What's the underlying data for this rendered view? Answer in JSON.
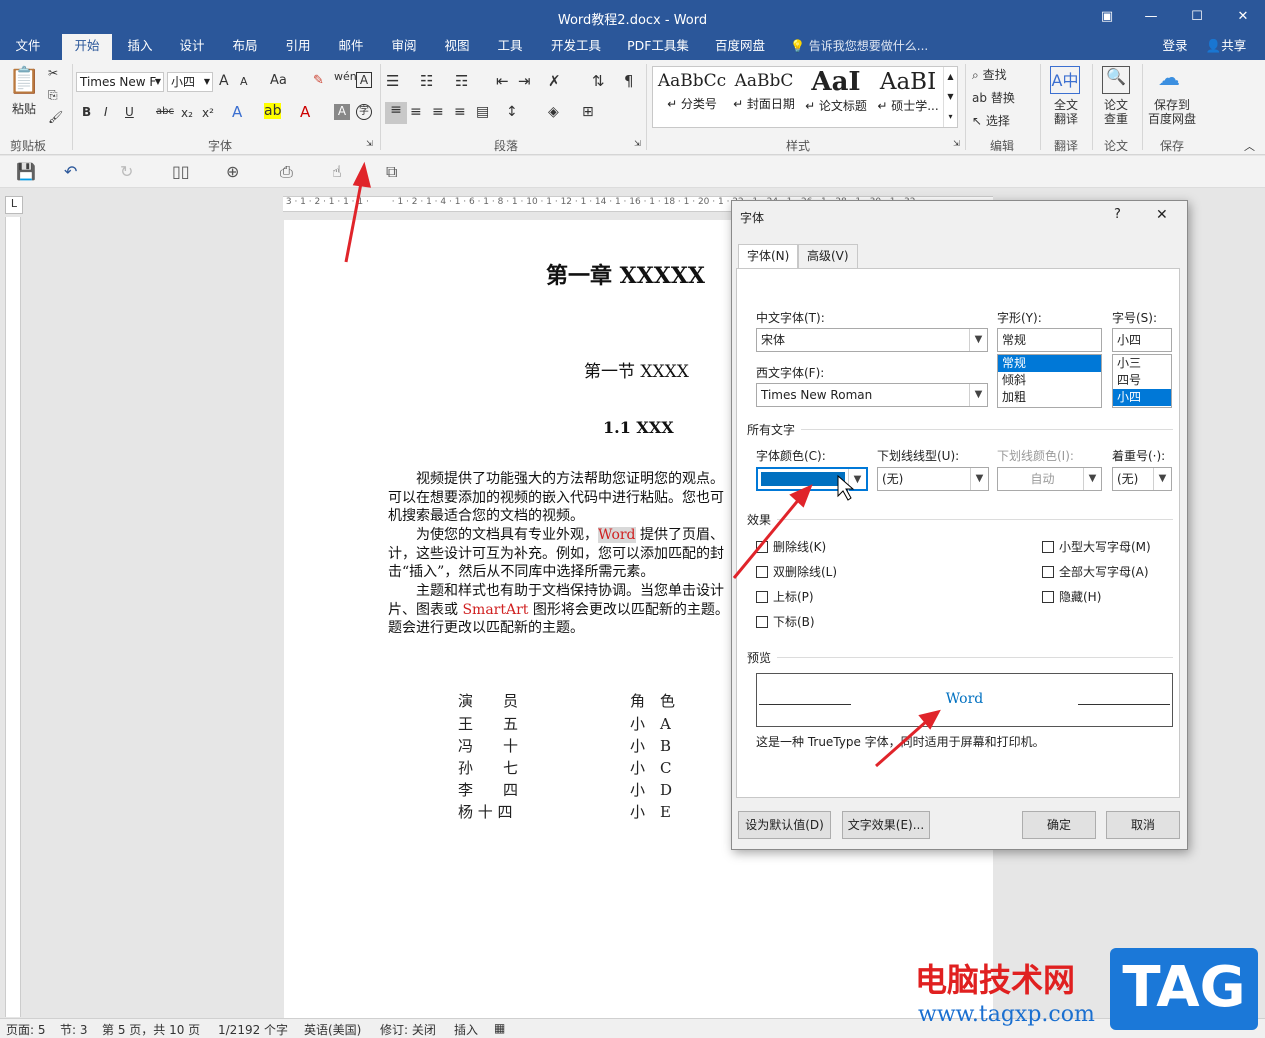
{
  "window": {
    "title": "Word教程2.docx - Word"
  },
  "tabs": [
    "文件",
    "开始",
    "插入",
    "设计",
    "布局",
    "引用",
    "邮件",
    "审阅",
    "视图",
    "工具",
    "开发工具",
    "PDF工具集",
    "百度网盘"
  ],
  "tellme": "告诉我您想要做什么...",
  "account": {
    "login": "登录",
    "share": "共享"
  },
  "ribbon": {
    "clipboard": {
      "paste": "粘贴",
      "label": "剪贴板"
    },
    "font": {
      "name": "Times New F",
      "size": "小四",
      "label": "字体",
      "bold": "B",
      "italic": "I",
      "underline": "U",
      "strike": "abc",
      "sub": "x₂",
      "sup": "x²",
      "grow": "A",
      "shrink": "A",
      "aa": "Aa",
      "clear": "✎"
    },
    "paragraph": {
      "label": "段落"
    },
    "styles": {
      "label": "样式",
      "items": [
        {
          "preview": "AaBbCc",
          "name": "↵ 分类号"
        },
        {
          "preview": "AaBbC",
          "name": "↵ 封面日期"
        },
        {
          "preview": "AaI",
          "name": "↵ 论文标题"
        },
        {
          "preview": "AaBI",
          "name": "↵ 硕士学..."
        }
      ]
    },
    "editing": {
      "find": "查找",
      "replace": "替换",
      "select": "选择",
      "label": "编辑"
    },
    "translate": {
      "btn": "全文\n翻译",
      "label": "翻译"
    },
    "paper": {
      "btn": "论文\n查重",
      "label": "论文"
    },
    "save": {
      "btn": "保存到\n百度网盘",
      "label": "保存"
    }
  },
  "document": {
    "chapter": "第一章  XXXXX",
    "section": "第一节  XXXX",
    "subsection": "1.1 XXX",
    "p1": [
      "　　视频提供了功能强大的方法帮助您证明您的观点。",
      "可以在想要添加的视频的嵌入代码中进行粘贴。您也可",
      "机搜索最适合您的文档的视频。"
    ],
    "p2_a": "　　为使您的文档具有专业外观，",
    "p2_word": "Word",
    "p2_b": " 提供了页眉、",
    "p2_lines": [
      "计，这些设计可互为补充。例如，您可以添加匹配的封",
      "击“插入”，然后从不同库中选择所需元素。"
    ],
    "p3": "　　主题和样式也有助于文档保持协调。当您单击设计",
    "p3_b": "片、图表或 ",
    "p3_smart": "SmartArt",
    "p3_c": " 图形将会更改以匹配新的主题。",
    "p3_d": "题会进行更改以匹配新的主题。",
    "cast_header": [
      "演　　员",
      "角　色"
    ],
    "cast": [
      [
        "王　　五",
        "小　A"
      ],
      [
        "冯　　十",
        "小　B"
      ],
      [
        "孙　　七",
        "小　C"
      ],
      [
        "李　　四",
        "小　D"
      ],
      [
        "杨 十 四",
        "小　E"
      ]
    ]
  },
  "status": {
    "page": "页面: 5",
    "section": "节: 3",
    "pages": "第 5 页，共 10 页",
    "words": "1/2192 个字",
    "lang": "英语(美国)",
    "track": "修订: 关闭",
    "insert": "插入"
  },
  "dialog": {
    "title": "字体",
    "help": "?",
    "close": "✕",
    "tab_font": "字体(N)",
    "tab_advanced": "高级(V)",
    "cn_font_label": "中文字体(T):",
    "cn_font": "宋体",
    "west_font_label": "西文字体(F):",
    "west_font": "Times New Roman",
    "style_label": "字形(Y):",
    "style_value": "常规",
    "style_list": [
      "常规",
      "倾斜",
      "加粗"
    ],
    "size_label": "字号(S):",
    "size_value": "小四",
    "size_list": [
      "小三",
      "四号",
      "小四"
    ],
    "all_text": "所有文字",
    "color_label": "字体颜色(C):",
    "color_value": "#0070c0",
    "underline_label": "下划线线型(U):",
    "underline_value": "(无)",
    "ucolor_label": "下划线颜色(I):",
    "ucolor_value": "自动",
    "emph_label": "着重号(·):",
    "emph_value": "(无)",
    "effects": "效果",
    "left_effects": [
      "删除线(K)",
      "双删除线(L)",
      "上标(P)",
      "下标(B)"
    ],
    "right_effects": [
      "小型大写字母(M)",
      "全部大写字母(A)",
      "隐藏(H)"
    ],
    "preview": "预览",
    "preview_text": "Word",
    "preview_note": "这是一种 TrueType 字体，同时适用于屏幕和打印机。",
    "btn_default": "设为默认值(D)",
    "btn_effects": "文字效果(E)...",
    "btn_ok": "确定",
    "btn_cancel": "取消"
  },
  "watermark": {
    "site": "电脑技术网",
    "url": "www.tagxp.com",
    "tag": "TAG"
  }
}
